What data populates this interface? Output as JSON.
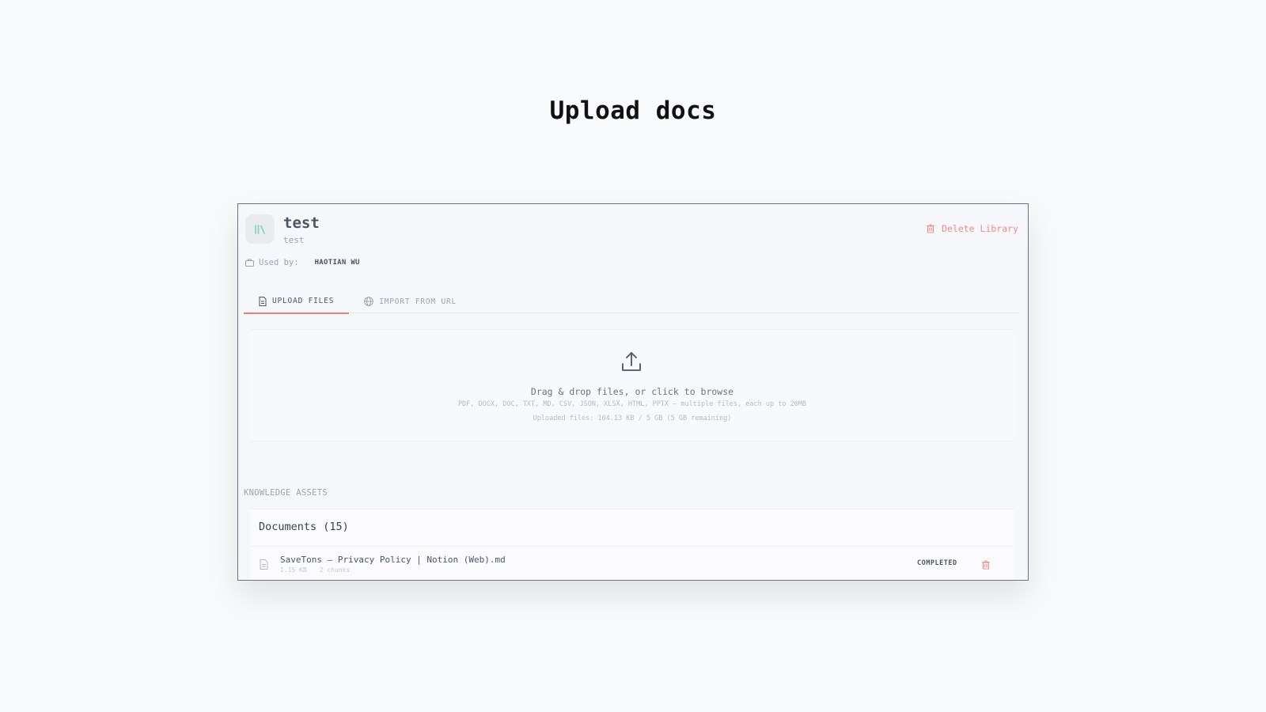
{
  "page": {
    "title": "Upload docs"
  },
  "library": {
    "icon": "books-icon",
    "name": "test",
    "description": "test",
    "delete_label": "Delete Library",
    "used_by_label": "Used by:",
    "used_by_user": "HAOTIAN WU"
  },
  "tabs": [
    {
      "label": "UPLOAD FILES",
      "icon": "file-icon",
      "active": true
    },
    {
      "label": "IMPORT FROM URL",
      "icon": "globe-icon",
      "active": false
    }
  ],
  "dropzone": {
    "icon": "upload-icon",
    "main_text": "Drag & drop files, or click to browse",
    "formats_text": "PDF, DOCX, DOC, TXT, MD, CSV, JSON, XLSX, HTML, PPTX — multiple files, each up to 20MB",
    "usage_text": "Uploaded files: 164.13 KB / 5 GB (5 GB remaining)"
  },
  "knowledge": {
    "section_label": "KNOWLEDGE ASSETS",
    "documents_title": "Documents (15)",
    "items": [
      {
        "name": "SaveTons – Privacy Policy | Notion (Web).md",
        "size": "1.15 KB",
        "chunks": "2 chunks",
        "status": "COMPLETED"
      }
    ]
  },
  "colors": {
    "accent": "#ef7d7d",
    "library_icon": "#7ed3b2",
    "delete": "#f28b8b"
  }
}
